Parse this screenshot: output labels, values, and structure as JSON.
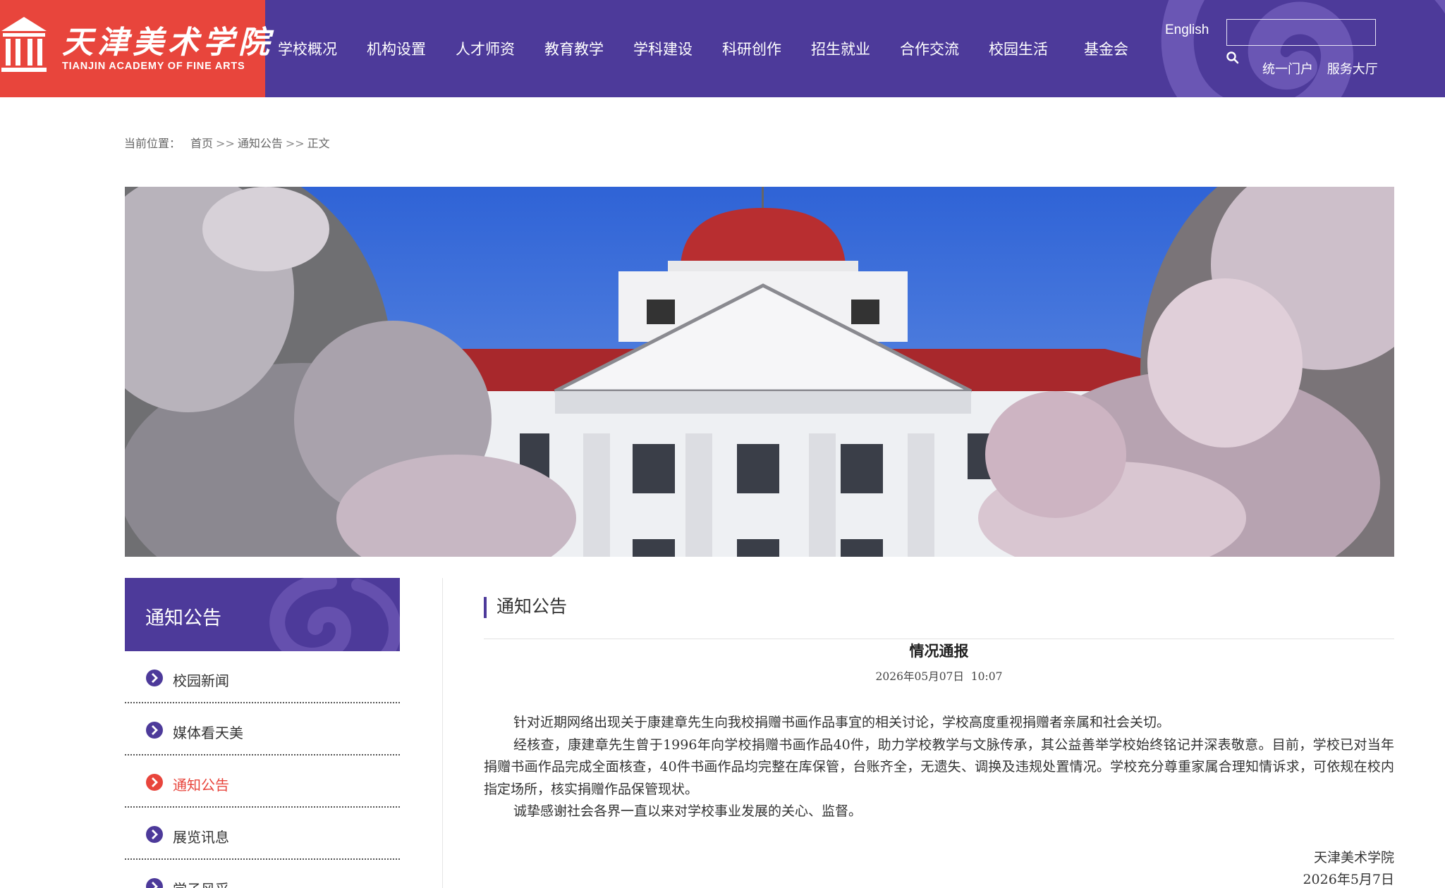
{
  "header": {
    "logo_cn": "天津美术学院",
    "logo_en": "TIANJIN ACADEMY OF FINE ARTS",
    "nav": [
      "学校概况",
      "机构设置",
      "人才师资",
      "教育教学",
      "学科建设",
      "科研创作",
      "招生就业",
      "合作交流",
      "校园生活",
      "基金会"
    ],
    "english_label": "English",
    "search_placeholder": "",
    "link_portal": "统一门户",
    "link_service": "服务大厅",
    "colors": {
      "brand_purple": "#4d3a9a",
      "logo_red": "#e8453c"
    }
  },
  "breadcrumb": {
    "prefix": "当前位置：",
    "items": [
      "首页",
      "通知公告",
      "正文"
    ],
    "separator": ">>"
  },
  "sidebar": {
    "title": "通知公告",
    "items": [
      {
        "label": "校园新闻",
        "active": false
      },
      {
        "label": "媒体看天美",
        "active": false
      },
      {
        "label": "通知公告",
        "active": true
      },
      {
        "label": "展览讯息",
        "active": false
      },
      {
        "label": "学子风采",
        "active": false
      }
    ]
  },
  "content": {
    "section_title": "通知公告",
    "article_title": "情况通报",
    "article_date": "2026年05月07日  10:07",
    "paragraphs": [
      "针对近期网络出现关于康建章先生向我校捐赠书画作品事宜的相关讨论，学校高度重视捐赠者亲属和社会关切。",
      "经核查，康建章先生曾于1996年向学校捐赠书画作品40件，助力学校教学与文脉传承，其公益善举学校始终铭记并深表敬意。目前，学校已对当年捐赠书画作品完成全面核查，40件书画作品均完整在库保管，台账齐全，无遗失、调换及违规处置情况。学校充分尊重家属合理知情诉求，可依规在校内指定场所，核实捐赠作品保管现状。",
      "诚挚感谢社会各界一直以来对学校事业发展的关心、监督。"
    ],
    "sign_org": "天津美术学院",
    "sign_date": "2026年5月7日"
  }
}
